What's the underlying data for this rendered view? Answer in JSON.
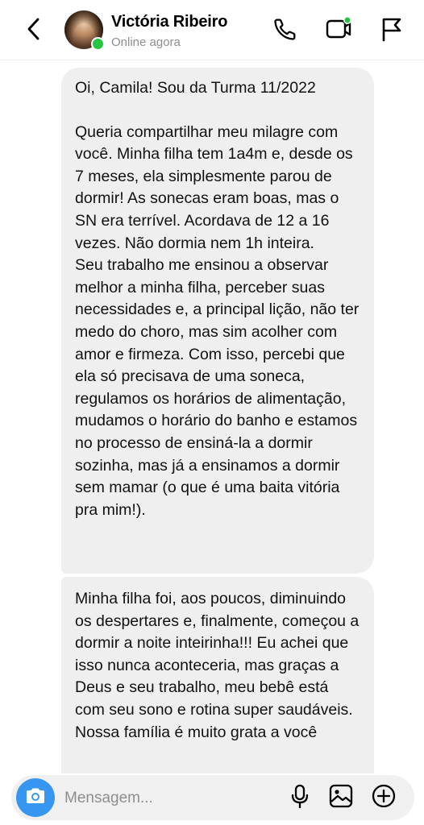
{
  "header": {
    "contact_name": "Victória Ribeiro",
    "status": "Online agora",
    "icons": {
      "back": "chevron-left-icon",
      "call": "phone-icon",
      "video": "video-camera-icon",
      "report": "flag-icon"
    }
  },
  "messages": [
    {
      "paragraphs": [
        "Oi, Camila! Sou da Turma 11/2022",
        "Queria compartilhar meu milagre com você. Minha filha tem 1a4m e, desde os 7 meses, ela simplesmente parou de dormir! As sonecas eram boas, mas o SN era terrível. Acordava de 12 a 16 vezes. Não dormia nem 1h inteira.",
        "Seu trabalho me ensinou a observar melhor a minha filha, perceber suas necessidades e, a principal lição, não ter medo do choro, mas sim acolher com amor e firmeza. Com isso, percebi que ela só precisava de uma soneca, regulamos os horários de alimentação, mudamos o horário do banho e estamos no processo de ensiná-la a dormir sozinha, mas já a ensinamos a dormir sem mamar (o que é uma baita vitória pra mim!)."
      ]
    },
    {
      "paragraphs": [
        "Minha filha foi, aos poucos, diminuindo os despertares e, finalmente, começou a dormir a noite inteirinha!!! Eu achei que isso nunca aconteceria, mas graças a Deus e seu trabalho, meu bebê está com seu sono e rotina super saudáveis.",
        "Nossa família é muito grata a você"
      ]
    }
  ],
  "composer": {
    "placeholder": "Mensagem...",
    "icons": {
      "camera": "camera-icon",
      "mic": "microphone-icon",
      "gallery": "image-icon",
      "add": "plus-circle-icon"
    }
  },
  "colors": {
    "online": "#26c541",
    "bubble": "#efefef",
    "camera_button": "#3797f0",
    "composer": "#f0f0f0"
  }
}
